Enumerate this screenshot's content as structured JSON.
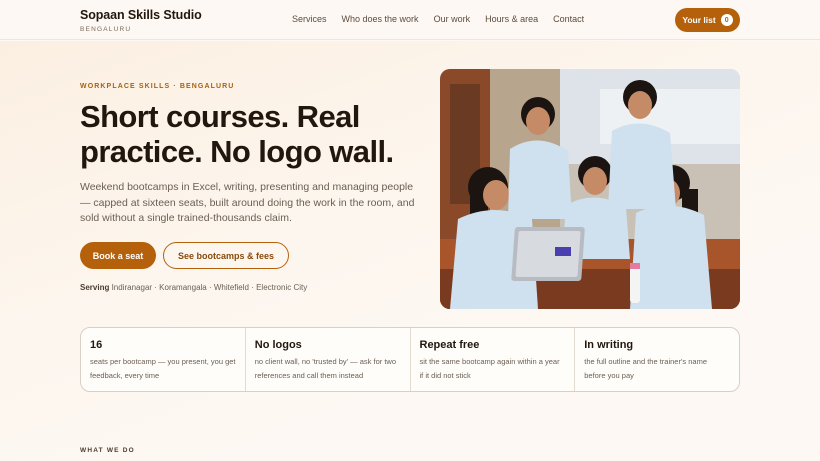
{
  "brand": {
    "name": "Sopaan Skills Studio",
    "city": "BENGALURU"
  },
  "nav": {
    "items": [
      {
        "label": "Services"
      },
      {
        "label": "Who does the work"
      },
      {
        "label": "Our work"
      },
      {
        "label": "Hours & area"
      },
      {
        "label": "Contact"
      }
    ],
    "list_button": {
      "label": "Your list",
      "count": "0"
    }
  },
  "hero": {
    "eyebrow": "WORKPLACE SKILLS · BENGALURU",
    "headline": "Short courses. Real practice. No logo wall.",
    "intro": "Weekend bootcamps in Excel, writing, presenting and managing people — capped at sixteen seats, built around doing the work in the room, and sold without a single trained-thousands claim.",
    "primary_cta": "Book a seat",
    "secondary_cta": "See bootcamps & fees",
    "serving_label": "Serving",
    "serving_areas": "Indiranagar · Koramangala · Whitefield · Electronic City",
    "photo_icon": "classroom-photo"
  },
  "stats": [
    {
      "title": "16",
      "text": "seats per bootcamp — you present, you get feedback, every time"
    },
    {
      "title": "No logos",
      "text": "no client wall, no 'trusted by' — ask for two references and call them instead"
    },
    {
      "title": "Repeat free",
      "text": "sit the same bootcamp again within a year if it did not stick"
    },
    {
      "title": "In writing",
      "text": "the full outline and the trainer's name before you pay"
    }
  ],
  "next_section": {
    "label": "WHAT WE DO"
  },
  "colors": {
    "accent": "#b5610c",
    "text": "#22170e",
    "background": "#fdf8f3"
  }
}
